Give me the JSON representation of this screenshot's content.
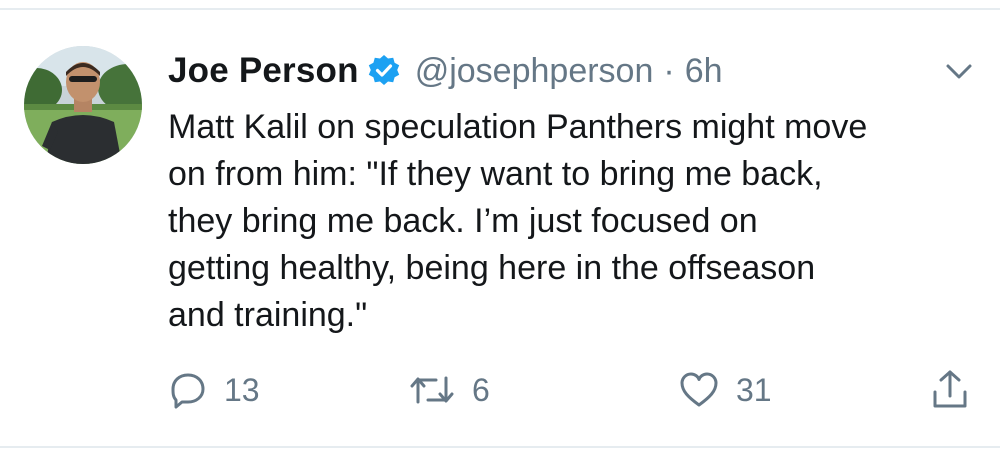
{
  "tweet": {
    "author": {
      "display_name": "Joe Person",
      "handle": "@josephperson",
      "verified": true
    },
    "separator": "·",
    "time": "6h",
    "text": "Matt Kalil on speculation Panthers might move\non from him: \"If they want to bring me back,\nthey bring me back. I’m just focused on\ngetting healthy, being here in the offseason\nand training.\"",
    "actions": {
      "reply_count": "13",
      "retweet_count": "6",
      "like_count": "31"
    }
  },
  "icons": {
    "verified": "verified-badge-icon",
    "more": "chevron-down-icon",
    "reply": "reply-icon",
    "retweet": "retweet-icon",
    "like": "heart-icon",
    "share": "share-icon"
  },
  "colors": {
    "text": "#14171a",
    "secondary": "#657786",
    "verified_blue": "#1da1f2",
    "divider": "#e6ecf0"
  }
}
